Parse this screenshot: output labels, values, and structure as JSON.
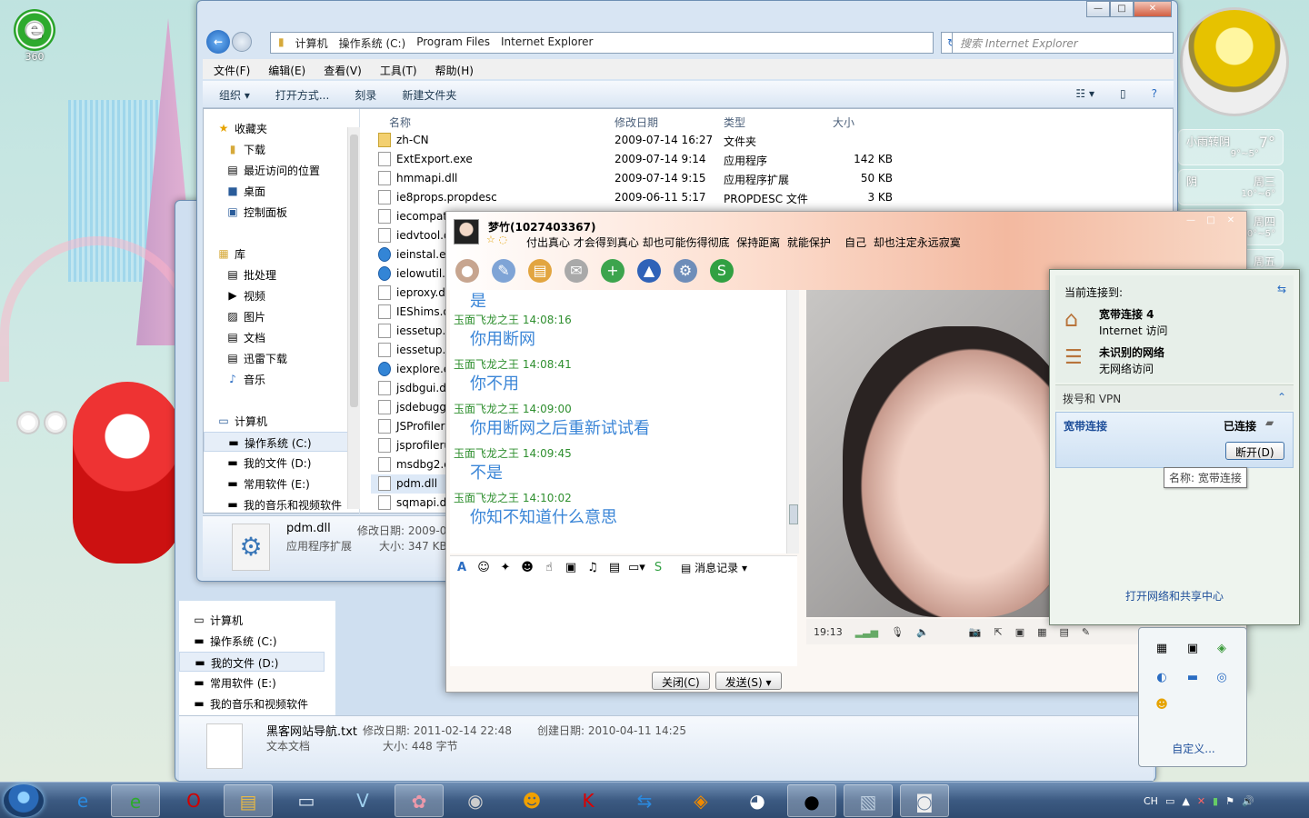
{
  "desktop": {
    "icon_label": "360",
    "weather": {
      "city": "小雨转阴",
      "temp": "7°",
      "range": "9°~5°",
      "day2": "周三",
      "range2": "10°~6°",
      "day2_cond": "阴",
      "day3": "周四",
      "range3": "10°~5°",
      "day4": "周五"
    }
  },
  "explorer": {
    "address": [
      "计算机",
      "操作系统 (C:)",
      "Program Files",
      "Internet Explorer"
    ],
    "search_placeholder": "搜索 Internet Explorer",
    "menu": [
      "文件(F)",
      "编辑(E)",
      "查看(V)",
      "工具(T)",
      "帮助(H)"
    ],
    "commands": [
      "组织 ▾",
      "打开方式...",
      "刻录",
      "新建文件夹"
    ],
    "nav": [
      "收藏夹",
      "下载",
      "最近访问的位置",
      "桌面",
      "控制面板",
      "库",
      "批处理",
      "视频",
      "图片",
      "文档",
      "迅雷下载",
      "音乐",
      "计算机",
      "操作系统 (C:)",
      "我的文件 (D:)",
      "常用软件 (E:)",
      "我的音乐和视频软件"
    ],
    "columns": [
      "名称",
      "修改日期",
      "类型",
      "大小"
    ],
    "files": [
      {
        "name": "zh-CN",
        "date": "2009-07-14 16:27",
        "type": "文件夹",
        "size": ""
      },
      {
        "name": "ExtExport.exe",
        "date": "2009-07-14 9:14",
        "type": "应用程序",
        "size": "142 KB"
      },
      {
        "name": "hmmapi.dll",
        "date": "2009-07-14 9:15",
        "type": "应用程序扩展",
        "size": "50 KB"
      },
      {
        "name": "ie8props.propdesc",
        "date": "2009-06-11 5:17",
        "type": "PROPDESC 文件",
        "size": "3 KB"
      },
      {
        "name": "iecompat.dll",
        "date": "",
        "type": "",
        "size": ""
      },
      {
        "name": "iedvtool.dll",
        "date": "",
        "type": "",
        "size": ""
      },
      {
        "name": "ieinstal.exe",
        "date": "",
        "type": "",
        "size": ""
      },
      {
        "name": "ielowutil.exe",
        "date": "",
        "type": "",
        "size": ""
      },
      {
        "name": "ieproxy.dll",
        "date": "",
        "type": "",
        "size": ""
      },
      {
        "name": "IEShims.dll",
        "date": "",
        "type": "",
        "size": ""
      },
      {
        "name": "iessetup.dll",
        "date": "",
        "type": "",
        "size": ""
      },
      {
        "name": "iessetup.dll",
        "date": "",
        "type": "",
        "size": ""
      },
      {
        "name": "iexplore.exe",
        "date": "",
        "type": "",
        "size": ""
      },
      {
        "name": "jsdbgui.dll",
        "date": "",
        "type": "",
        "size": ""
      },
      {
        "name": "jsdebuggeride.dll",
        "date": "",
        "type": "",
        "size": ""
      },
      {
        "name": "JSProfilerCore.dll",
        "date": "",
        "type": "",
        "size": ""
      },
      {
        "name": "jsprofilerui.dll",
        "date": "",
        "type": "",
        "size": ""
      },
      {
        "name": "msdbg2.dll",
        "date": "",
        "type": "",
        "size": ""
      },
      {
        "name": "pdm.dll",
        "date": "",
        "type": "",
        "size": ""
      },
      {
        "name": "sqmapi.dll",
        "date": "",
        "type": "",
        "size": ""
      }
    ],
    "detail": {
      "name": "pdm.dll",
      "type": "应用程序扩展",
      "date_label": "修改日期: 2009-0",
      "size_label": "大小: 347 KB"
    }
  },
  "back_window": {
    "nav": [
      "计算机",
      "操作系统 (C:)",
      "我的文件 (D:)",
      "常用软件 (E:)",
      "我的音乐和视频软件"
    ],
    "detail": {
      "name": "黑客网站导航.txt",
      "modified": "修改日期: 2011-02-14 22:48",
      "created": "创建日期: 2010-04-11 14:25",
      "type": "文本文档",
      "size": "大小: 448 字节"
    }
  },
  "qq": {
    "title": "梦竹(1027403367)",
    "signature": "付出真心 才会得到真心 却也可能伤得彻底  保持距离  就能保护    自己  却也注定永远寂寞",
    "messages": [
      {
        "name": "",
        "text": "是"
      },
      {
        "name": "玉面飞龙之王  14:08:16",
        "text": "你用断网"
      },
      {
        "name": "玉面飞龙之王  14:08:41",
        "text": "你不用"
      },
      {
        "name": "玉面飞龙之王  14:09:00",
        "text": "你用断网之后重新试试看"
      },
      {
        "name": "玉面飞龙之王  14:09:45",
        "text": "不是"
      },
      {
        "name": "玉面飞龙之王  14:10:02",
        "text": "你知不知道什么意思"
      }
    ],
    "history_label": "消息记录",
    "close_label": "关闭(C)",
    "send_label": "发送(S)",
    "video_time": "19:13"
  },
  "network": {
    "header": "当前连接到:",
    "conn1_name": "宽带连接  4",
    "conn1_status": "Internet 访问",
    "conn2_name": "未识别的网络",
    "conn2_status": "无网络访问",
    "vpn_header": "拨号和 VPN",
    "dial_name": "宽带连接",
    "dial_status": "已连接",
    "disconnect": "断开(D)",
    "tooltip": "名称: 宽带连接",
    "footer_link": "打开网络和共享中心"
  },
  "tray_popup": {
    "customize": "自定义..."
  },
  "taskbar": {
    "lang": "CH"
  }
}
